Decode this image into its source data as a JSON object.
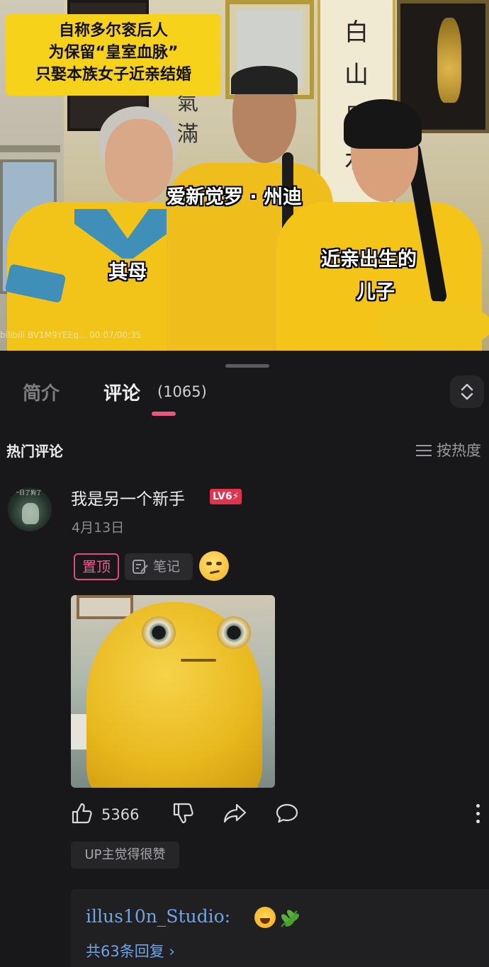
{
  "video": {
    "caption_lines": [
      "自称多尔衮后人",
      "为保留“皇室血脉”",
      "只娶本族女子近亲结婚"
    ],
    "label_father": "爱新觉罗 · 州迪",
    "label_mother": "其母",
    "label_son_line1": "近亲出生的",
    "label_son_line2": "儿子",
    "watermark": "bilibili BV1M9YEEq... 00:07/00:35",
    "calligraphy_right": [
      "白",
      "山",
      "黑",
      "水"
    ],
    "calligraphy_mid": [
      "氣",
      "滿"
    ]
  },
  "tabs": {
    "intro": "简介",
    "comments": "评论",
    "comments_count": "(1065)"
  },
  "hot": {
    "title": "热门评论",
    "sort_label": "按热度"
  },
  "comment": {
    "avatar_text": "一日了狗了",
    "username": "我是另一个新手",
    "level": "LV6⚡",
    "date": "4月13日",
    "pin_tag": "置顶",
    "note_tag": "笔记",
    "likes": "5366",
    "up_liked": "UP主觉得很赞"
  },
  "reply": {
    "user": "illus10n_Studio:",
    "count_text": "共63条回复 ›"
  },
  "icons": [
    "thumb-up-icon",
    "thumb-down-icon",
    "share-icon",
    "comment-icon",
    "more-icon",
    "expand-icon",
    "sort-lines-icon",
    "note-edit-icon"
  ],
  "colors": {
    "background": "#18181a",
    "accent_pink": "#e9577f",
    "link_blue": "#6da5e6",
    "caption_yellow": "#f7d21b"
  }
}
